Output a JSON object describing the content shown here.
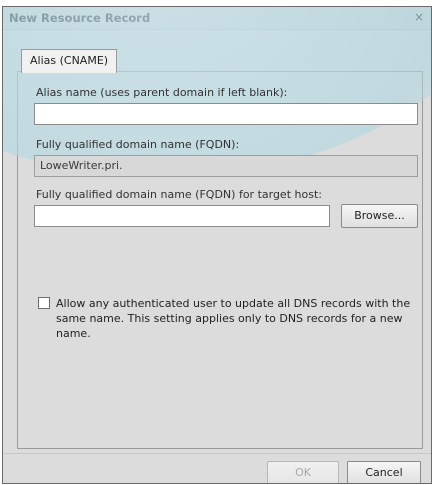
{
  "dialog": {
    "title": "New Resource Record",
    "close_symbol": "×"
  },
  "tabs": [
    {
      "label": "Alias (CNAME)",
      "selected": true
    }
  ],
  "form": {
    "alias_label": "Alias name (uses parent domain if left blank):",
    "alias_value": "",
    "fqdn_label": "Fully qualified domain name (FQDN):",
    "fqdn_value": "LoweWriter.pri.",
    "target_label": "Fully qualified domain name (FQDN) for target host:",
    "target_value": "",
    "browse_label": "Browse...",
    "checkbox_checked": false,
    "checkbox_text": "Allow any authenticated user to update all DNS records with the same name. This setting applies only to DNS records for a new name."
  },
  "footer": {
    "ok_label": "OK",
    "ok_enabled": false,
    "cancel_label": "Cancel"
  },
  "colors": {
    "dialog_bg": "#dcdcdc",
    "glass_tint": "#b4d8e2",
    "disabled_text": "#a8a8a8"
  }
}
